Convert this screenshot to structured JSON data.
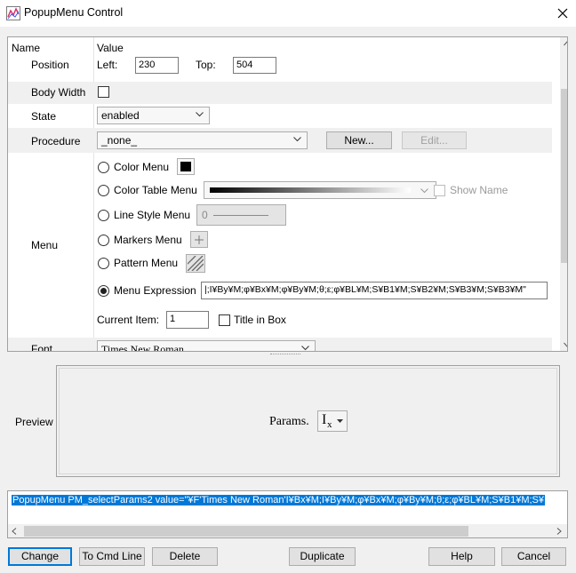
{
  "window": {
    "title": "PopupMenu Control"
  },
  "colors": {
    "selection": "#0078d7",
    "panel_alt": "#f0f0f0"
  },
  "header": {
    "name": "Name",
    "value": "Value"
  },
  "position": {
    "label": "Position",
    "left_label": "Left:",
    "left_value": "230",
    "top_label": "Top:",
    "top_value": "504"
  },
  "body_width": {
    "label": "Body Width",
    "checked": false
  },
  "state": {
    "label": "State",
    "value": "enabled"
  },
  "procedure": {
    "label": "Procedure",
    "value": "_none_",
    "new_label": "New...",
    "edit_label": "Edit..."
  },
  "menu": {
    "label": "Menu",
    "color_menu": "Color Menu",
    "color_table_menu": "Color Table Menu",
    "show_name": "Show Name",
    "line_style_menu": "Line Style Menu",
    "line_style_value": "0",
    "markers_menu": "Markers Menu",
    "pattern_menu": "Pattern Menu",
    "menu_expression": "Menu Expression",
    "menu_expression_value": "|;I¥By¥M;φ¥Bx¥M;φ¥By¥M;θ;ε;φ¥BL¥M;S¥B1¥M;S¥B2¥M;S¥B3¥M;S¥B3¥M\"",
    "selected": "menu_expression",
    "current_item_label": "Current Item:",
    "current_item_value": "1",
    "title_in_box": "Title in Box"
  },
  "font": {
    "label": "Font",
    "value": "Times New Roman"
  },
  "preview": {
    "label": "Preview",
    "params_text": "Params.",
    "popup_main": "I",
    "popup_sub": "x"
  },
  "command": {
    "text": "PopupMenu PM_selectParams2 value=\"¥F'Times New Roman'I¥Bx¥M;I¥By¥M;φ¥Bx¥M;φ¥By¥M;θ;ε;φ¥BL¥M;S¥B1¥M;S¥"
  },
  "buttons": {
    "change": "Change",
    "to_cmd_line": "To Cmd Line",
    "delete": "Delete",
    "duplicate": "Duplicate",
    "help": "Help",
    "cancel": "Cancel"
  }
}
